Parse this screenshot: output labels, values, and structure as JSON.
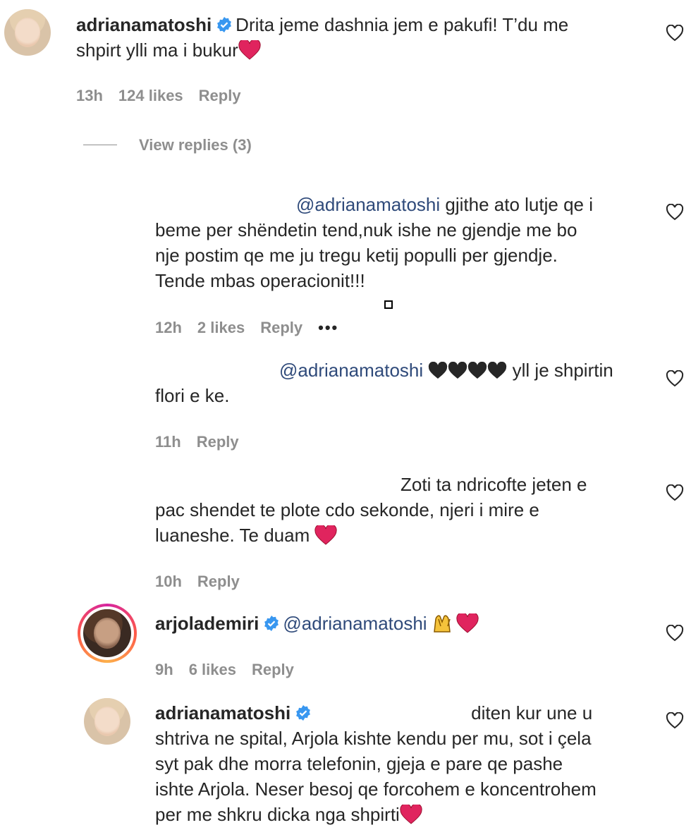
{
  "comments": [
    {
      "username": "adrianamatoshi",
      "line1": "Drita jeme dashnia jem e pakufi! T’du me",
      "line2": "shpirt ylli ma i bukur",
      "time": "13h",
      "likes": "124 likes",
      "reply": "Reply",
      "view_replies": "View replies (3)"
    },
    {
      "mention": "@adrianamatoshi",
      "line1_rest": "gjithe ato lutje qe i",
      "line2": "beme per shëndetin tend,nuk ishe ne gjendje me bo",
      "line3": "nje postim qe me ju tregu ketij populli per gjendje.",
      "line4": "Tende mbas operacionit!!!",
      "time": "12h",
      "likes": "2 likes",
      "reply": "Reply",
      "more": "•••"
    },
    {
      "mention": "@adrianamatoshi",
      "line1_rest": "yll je shpirtin",
      "line2": "flori e ke.",
      "time": "11h",
      "reply": "Reply"
    },
    {
      "line1": "Zoti ta ndricofte jeten e",
      "line2": "pac shendet te plote cdo sekonde, njeri i mire e",
      "line3": "luaneshe. Te duam",
      "time": "10h",
      "reply": "Reply"
    },
    {
      "username": "arjolademiri",
      "mention": "@adrianamatoshi",
      "time": "9h",
      "likes": "6 likes",
      "reply": "Reply"
    },
    {
      "username": "adrianamatoshi",
      "line1": "diten kur une u",
      "line2": "shtriva ne spital, Arjola kishte kendu per mu, sot i çela",
      "line3": "syt pak dhe morra telefonin, gjeja e pare qe pashe",
      "line4": "ishte Arjola. Neser besoj qe forcohem e koncentrohem",
      "line5": "per me shkru dicka nga shpirti"
    }
  ],
  "icons": {
    "like": "heart-outline-icon",
    "verified": "verified-badge-icon",
    "emoji_heart": "red-heart-emoji",
    "black_heart": "black-heart-emoji",
    "raised_hands": "raised-hands-emoji"
  },
  "colors": {
    "mention": "#2f4a7a",
    "verified": "#3897f0",
    "heart": "#e0245e",
    "meta": "#8e8e8e"
  }
}
